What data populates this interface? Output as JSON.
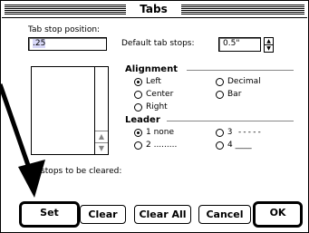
{
  "window": {
    "title": "Tabs"
  },
  "tab_stop": {
    "label": "Tab stop position:",
    "value": ".25"
  },
  "default_tab": {
    "label": "Default tab stops:",
    "value": "0.5\""
  },
  "alignment": {
    "title": "Alignment",
    "options": [
      "Left",
      "Decimal",
      "Center",
      "Bar",
      "Right"
    ],
    "selected": "Left"
  },
  "leader": {
    "title": "Leader",
    "options": [
      "1 none",
      "3 -----",
      "2 .........",
      "4 ____"
    ],
    "selected": "1 none"
  },
  "cleared": {
    "label": "Tab stops to be cleared:",
    "visible_fragment_1": "ab stops to be cleared:",
    "visible_fragment_2": "'"
  },
  "buttons": {
    "set": "Set",
    "clear": "Clear",
    "clear_all": "Clear All",
    "cancel": "Cancel",
    "ok": "OK"
  },
  "icons": {
    "arrow": "black-pointer-arrow-icon",
    "stepper": "up-down-stepper-icon"
  },
  "colors": {
    "selection": "#d8d8f8",
    "frame": "#000000",
    "background": "#ffffff"
  }
}
